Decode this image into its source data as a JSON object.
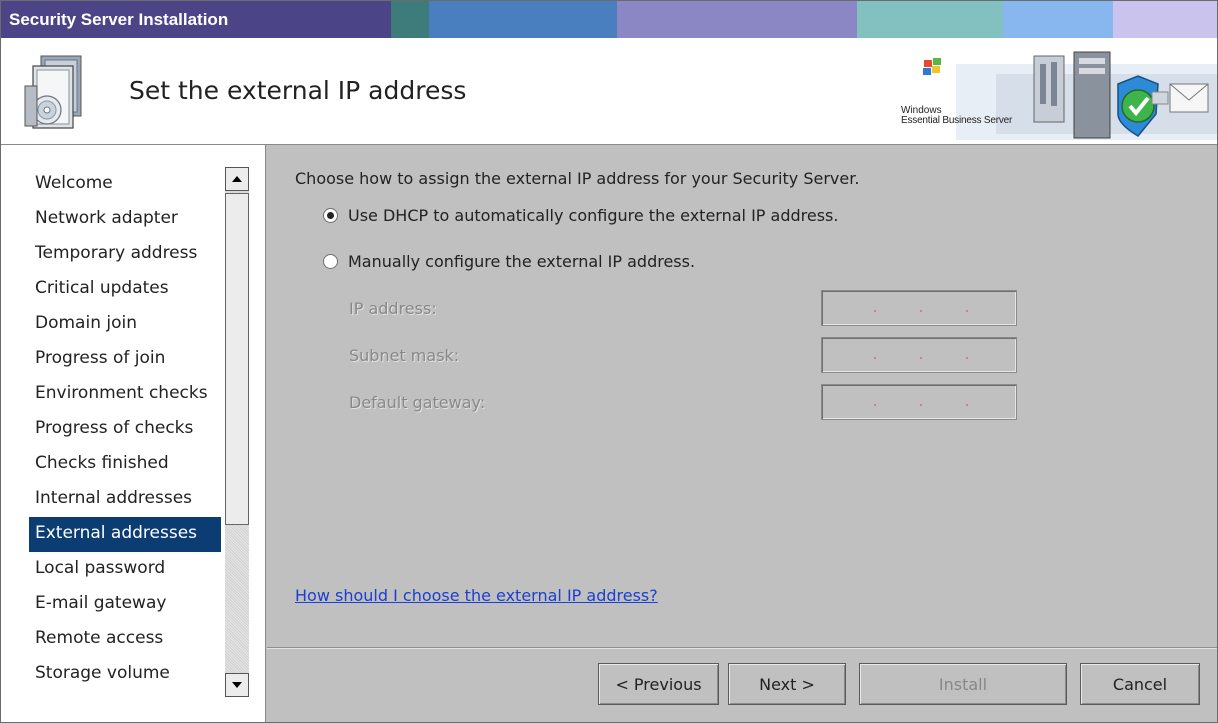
{
  "window": {
    "title": "Security Server Installation"
  },
  "header": {
    "title": "Set the external IP address",
    "brand_line1": "Windows",
    "brand_line2": "Essential Business Server"
  },
  "nav": {
    "items": [
      {
        "label": "Welcome",
        "active": false
      },
      {
        "label": "Network adapter",
        "active": false
      },
      {
        "label": "Temporary address",
        "active": false
      },
      {
        "label": "Critical updates",
        "active": false
      },
      {
        "label": "Domain join",
        "active": false
      },
      {
        "label": "Progress of join",
        "active": false
      },
      {
        "label": "Environment checks",
        "active": false
      },
      {
        "label": "Progress of checks",
        "active": false
      },
      {
        "label": "Checks finished",
        "active": false
      },
      {
        "label": "Internal addresses",
        "active": false
      },
      {
        "label": "External addresses",
        "active": true
      },
      {
        "label": "Local password",
        "active": false
      },
      {
        "label": "E-mail gateway",
        "active": false
      },
      {
        "label": "Remote access",
        "active": false
      },
      {
        "label": "Storage volume",
        "active": false
      }
    ]
  },
  "main": {
    "intro": "Choose how to assign the external IP address for your Security Server.",
    "option_dhcp": "Use DHCP to automatically configure the external IP address.",
    "option_manual": "Manually configure the external IP address.",
    "selected_option": "dhcp",
    "fields": {
      "ip_label": "IP address:",
      "subnet_label": "Subnet mask:",
      "gateway_label": "Default gateway:"
    },
    "help_link": "How should I choose the external IP address?"
  },
  "buttons": {
    "previous": "< Previous",
    "next": "Next >",
    "install": "Install",
    "cancel": "Cancel"
  },
  "colors": {
    "nav_active_bg": "#0b3d73",
    "link": "#1a3fd1",
    "window_bg": "#c0c0c0"
  }
}
